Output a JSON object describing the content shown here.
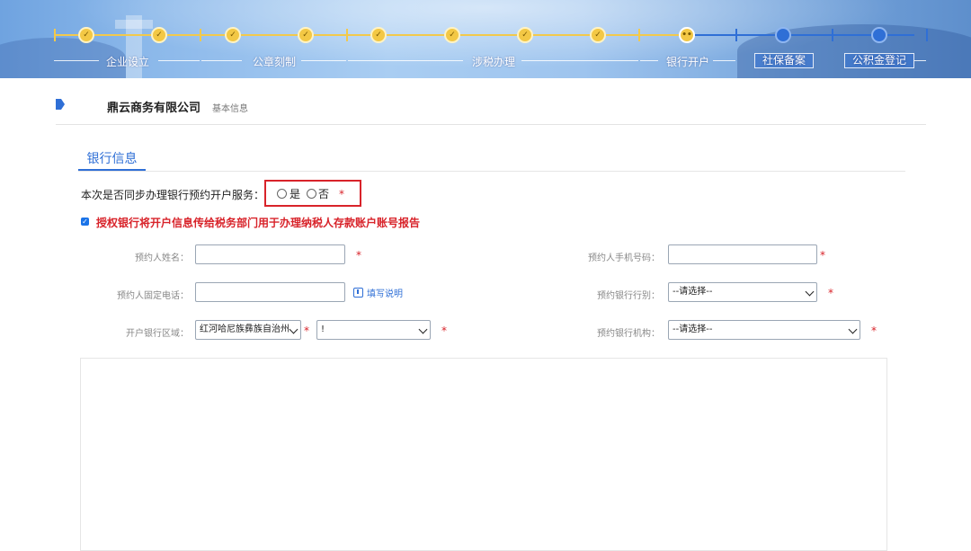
{
  "progress": {
    "stages": [
      {
        "label": "企业设立",
        "state": "done"
      },
      {
        "label": "公章刻制",
        "state": "done"
      },
      {
        "label": "涉税办理",
        "state": "done"
      },
      {
        "label": "银行开户",
        "state": "current"
      },
      {
        "label": "社保备案",
        "state": "pending"
      },
      {
        "label": "公积金登记",
        "state": "pending"
      }
    ],
    "done_mark": "✓",
    "current_mark": "••"
  },
  "header": {
    "company_name": "鼎云商务有限公司",
    "breadcrumb": "基本信息"
  },
  "tab": {
    "label": "银行信息"
  },
  "question": {
    "text": "本次是否同步办理银行预约开户服务：",
    "option_yes": "是",
    "option_no": "否",
    "required_mark": "*"
  },
  "authorize": {
    "checked": true,
    "text": "授权银行将开户信息传给税务部门用于办理纳税人存款账户账号报告"
  },
  "form": {
    "applicant_name_label": "预约人姓名：",
    "applicant_phone_label": "预约人手机号码：",
    "landline_label": "预约人固定电话：",
    "help_label": "填写说明",
    "bank_type_label": "预约银行行别：",
    "bank_type_value": "--请选择--",
    "region_label": "开户银行区域：",
    "region_value": "红河哈尼族彝族自治州",
    "region_sub_value": "!",
    "bank_branch_label": "预约银行机构：",
    "bank_branch_value": "--请选择--",
    "required_mark": "*"
  },
  "colors": {
    "accent": "#2f6fd6",
    "required": "#d8232a",
    "step_done": "#f3c845"
  }
}
